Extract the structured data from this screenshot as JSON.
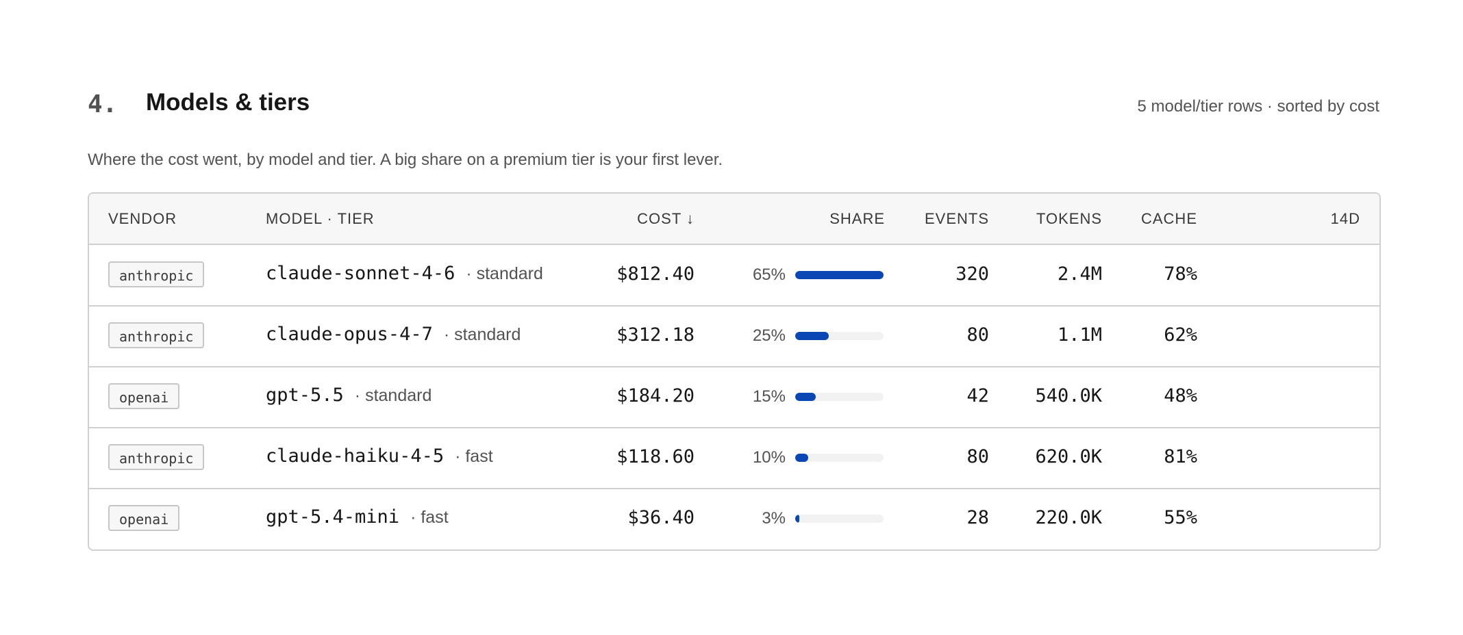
{
  "section": {
    "number": "4.",
    "title": "Models & tiers",
    "meta": "5 model/tier rows · sorted by cost",
    "description": "Where the cost went, by model and tier. A big share on a premium tier is your first lever."
  },
  "table": {
    "headers": {
      "vendor": "VENDOR",
      "model_tier": "MODEL · TIER",
      "cost": "COST ↓",
      "share": "SHARE",
      "events": "EVENTS",
      "tokens": "TOKENS",
      "cache": "CACHE",
      "d14": "14D"
    },
    "rows": [
      {
        "vendor": "anthropic",
        "model": "claude-sonnet-4-6",
        "tier": "· standard",
        "cost": "$812.40",
        "share": "65%",
        "share_value": 1.0,
        "events": "320",
        "tokens": "2.4M",
        "cache": "78%"
      },
      {
        "vendor": "anthropic",
        "model": "claude-opus-4-7",
        "tier": "· standard",
        "cost": "$312.18",
        "share": "25%",
        "share_value": 0.38,
        "events": "80",
        "tokens": "1.1M",
        "cache": "62%"
      },
      {
        "vendor": "openai",
        "model": "gpt-5.5",
        "tier": "· standard",
        "cost": "$184.20",
        "share": "15%",
        "share_value": 0.23,
        "events": "42",
        "tokens": "540.0K",
        "cache": "48%"
      },
      {
        "vendor": "anthropic",
        "model": "claude-haiku-4-5",
        "tier": "· fast",
        "cost": "$118.60",
        "share": "10%",
        "share_value": 0.15,
        "events": "80",
        "tokens": "620.0K",
        "cache": "81%"
      },
      {
        "vendor": "openai",
        "model": "gpt-5.4-mini",
        "tier": "· fast",
        "cost": "$36.40",
        "share": "3%",
        "share_value": 0.05,
        "events": "28",
        "tokens": "220.0K",
        "cache": "55%"
      }
    ]
  },
  "colors": {
    "accent": "#0a47b5",
    "track": "#f2f2f2"
  }
}
